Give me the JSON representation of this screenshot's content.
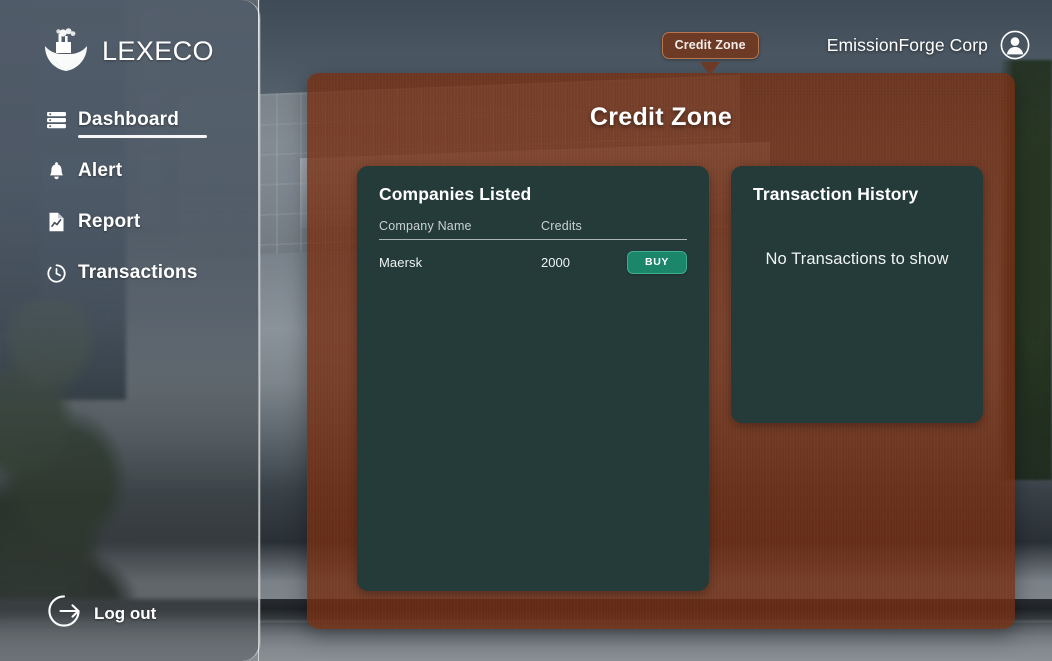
{
  "brand": {
    "name": "LEXECO",
    "logo_icon": "factory-leaf-logo-icon"
  },
  "sidebar": {
    "items": [
      {
        "label": "Dashboard",
        "icon": "server-stack-icon",
        "active": true
      },
      {
        "label": "Alert",
        "icon": "bell-icon",
        "active": false
      },
      {
        "label": "Report",
        "icon": "document-chart-icon",
        "active": false
      },
      {
        "label": "Transactions",
        "icon": "clock-icon",
        "active": false
      }
    ],
    "logout": {
      "label": "Log out",
      "icon": "logout-arrow-icon"
    }
  },
  "topbar": {
    "badge_label": "Credit Zone",
    "corp_name": "EmissionForge Corp",
    "avatar_icon": "user-avatar-icon"
  },
  "panel": {
    "title": "Credit Zone",
    "companies_card": {
      "title": "Companies Listed",
      "columns": [
        "Company Name",
        "Credits",
        ""
      ],
      "rows": [
        {
          "company": "Maersk",
          "credits": "2000",
          "action_label": "BUY"
        }
      ]
    },
    "history_card": {
      "title": "Transaction History",
      "empty_message": "No Transactions to show"
    }
  },
  "colors": {
    "panel_orange": "#752e11",
    "card_teal": "#243b39",
    "buy_green": "#1b8669",
    "sidebar_grey": "#535e6b",
    "badge_brown": "#6d3a26"
  }
}
